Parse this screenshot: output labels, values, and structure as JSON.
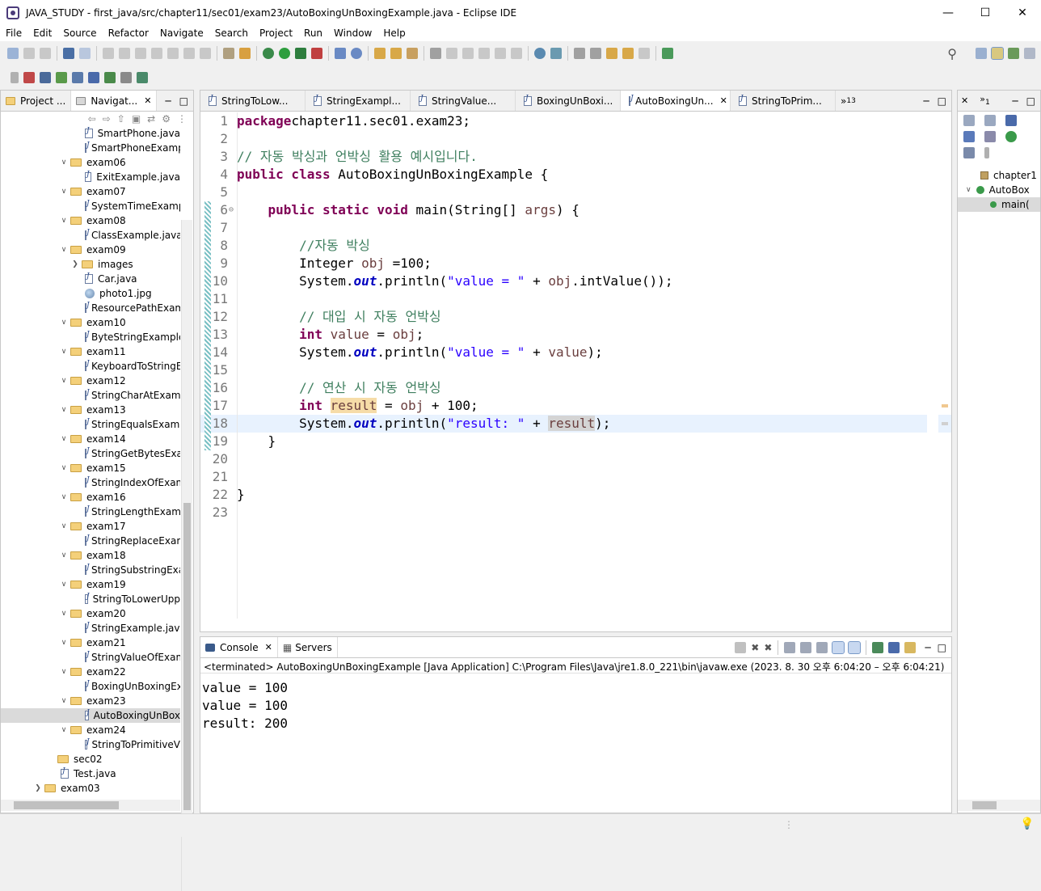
{
  "window": {
    "title": "JAVA_STUDY - first_java/src/chapter11/sec01/exam23/AutoBoxingUnBoxingExample.java - Eclipse IDE"
  },
  "menu": [
    "File",
    "Edit",
    "Source",
    "Refactor",
    "Navigate",
    "Search",
    "Project",
    "Run",
    "Window",
    "Help"
  ],
  "left_panel": {
    "tabs": [
      "Project ...",
      "Navigat..."
    ],
    "tree": [
      {
        "label": "SmartPhone.java",
        "type": "file",
        "indent": 2
      },
      {
        "label": "SmartPhoneExamp",
        "type": "file",
        "indent": 2
      },
      {
        "label": "exam06",
        "type": "folder",
        "indent": 1,
        "open": true
      },
      {
        "label": "ExitExample.java",
        "type": "file",
        "indent": 2
      },
      {
        "label": "exam07",
        "type": "folder",
        "indent": 1,
        "open": true
      },
      {
        "label": "SystemTimeExamp",
        "type": "file",
        "indent": 2
      },
      {
        "label": "exam08",
        "type": "folder",
        "indent": 1,
        "open": true
      },
      {
        "label": "ClassExample.java",
        "type": "file",
        "indent": 2
      },
      {
        "label": "exam09",
        "type": "folder",
        "indent": 1,
        "open": true
      },
      {
        "label": "images",
        "type": "folder",
        "indent": 2,
        "open": false
      },
      {
        "label": "Car.java",
        "type": "file",
        "indent": 2
      },
      {
        "label": "photo1.jpg",
        "type": "image",
        "indent": 2
      },
      {
        "label": "ResourcePathExam",
        "type": "file",
        "indent": 2
      },
      {
        "label": "exam10",
        "type": "folder",
        "indent": 1,
        "open": true
      },
      {
        "label": "ByteStringExample",
        "type": "file",
        "indent": 2
      },
      {
        "label": "exam11",
        "type": "folder",
        "indent": 1,
        "open": true
      },
      {
        "label": "KeyboardToStringE",
        "type": "file",
        "indent": 2
      },
      {
        "label": "exam12",
        "type": "folder",
        "indent": 1,
        "open": true
      },
      {
        "label": "StringCharAtExam",
        "type": "file",
        "indent": 2
      },
      {
        "label": "exam13",
        "type": "folder",
        "indent": 1,
        "open": true
      },
      {
        "label": "StringEqualsExamp",
        "type": "file",
        "indent": 2
      },
      {
        "label": "exam14",
        "type": "folder",
        "indent": 1,
        "open": true
      },
      {
        "label": "StringGetBytesExar",
        "type": "file",
        "indent": 2
      },
      {
        "label": "exam15",
        "type": "folder",
        "indent": 1,
        "open": true
      },
      {
        "label": "StringIndexOfExam",
        "type": "file",
        "indent": 2
      },
      {
        "label": "exam16",
        "type": "folder",
        "indent": 1,
        "open": true
      },
      {
        "label": "StringLengthExam",
        "type": "file",
        "indent": 2
      },
      {
        "label": "exam17",
        "type": "folder",
        "indent": 1,
        "open": true
      },
      {
        "label": "StringReplaceExam",
        "type": "file",
        "indent": 2
      },
      {
        "label": "exam18",
        "type": "folder",
        "indent": 1,
        "open": true
      },
      {
        "label": "StringSubstringExa",
        "type": "file",
        "indent": 2
      },
      {
        "label": "exam19",
        "type": "folder",
        "indent": 1,
        "open": true
      },
      {
        "label": "StringToLowerUpp",
        "type": "file",
        "indent": 2
      },
      {
        "label": "exam20",
        "type": "folder",
        "indent": 1,
        "open": true
      },
      {
        "label": "StringExample.java",
        "type": "file",
        "indent": 2
      },
      {
        "label": "exam21",
        "type": "folder",
        "indent": 1,
        "open": true
      },
      {
        "label": "StringValueOfExam",
        "type": "file",
        "indent": 2
      },
      {
        "label": "exam22",
        "type": "folder",
        "indent": 1,
        "open": true
      },
      {
        "label": "BoxingUnBoxingEx",
        "type": "file",
        "indent": 2
      },
      {
        "label": "exam23",
        "type": "folder",
        "indent": 1,
        "open": true
      },
      {
        "label": "AutoBoxingUnBox",
        "type": "file",
        "indent": 2,
        "selected": true
      },
      {
        "label": "exam24",
        "type": "folder",
        "indent": 1,
        "open": true
      },
      {
        "label": "StringToPrimitiveV",
        "type": "file",
        "indent": 2
      },
      {
        "label": "sec02",
        "type": "folder",
        "indent": 0.5,
        "open": null
      },
      {
        "label": "Test.java",
        "type": "file",
        "indent": 0.5
      },
      {
        "label": "exam03",
        "type": "folder",
        "indent": 0,
        "open": false
      }
    ]
  },
  "editor": {
    "tabs": [
      {
        "label": "StringToLow...",
        "active": false
      },
      {
        "label": "StringExampl...",
        "active": false
      },
      {
        "label": "StringValue...",
        "active": false
      },
      {
        "label": "BoxingUnBoxi...",
        "active": false
      },
      {
        "label": "AutoBoxingUn...",
        "active": true
      },
      {
        "label": "StringToPrim...",
        "active": false
      }
    ],
    "overflow_label": "»",
    "overflow_count": "13"
  },
  "outline": {
    "items": [
      {
        "label": "chapter1",
        "indent": 0
      },
      {
        "label": "AutoBox",
        "indent": 1
      },
      {
        "label": "main(",
        "indent": 2
      }
    ]
  },
  "console": {
    "tabs": [
      "Console",
      "Servers"
    ],
    "header": "<terminated> AutoBoxingUnBoxingExample [Java Application] C:\\Program Files\\Java\\jre1.8.0_221\\bin\\javaw.exe  (2023. 8. 30 오후 6:04:20 – 오후 6:04:21)",
    "output": [
      "value = 100",
      "value = 100",
      "result: 200"
    ]
  },
  "colors": {
    "keyword": "#7f0055",
    "comment": "#3f7f5f",
    "string": "#2a00ff",
    "field": "#0000c0",
    "selection": "#dadada"
  }
}
